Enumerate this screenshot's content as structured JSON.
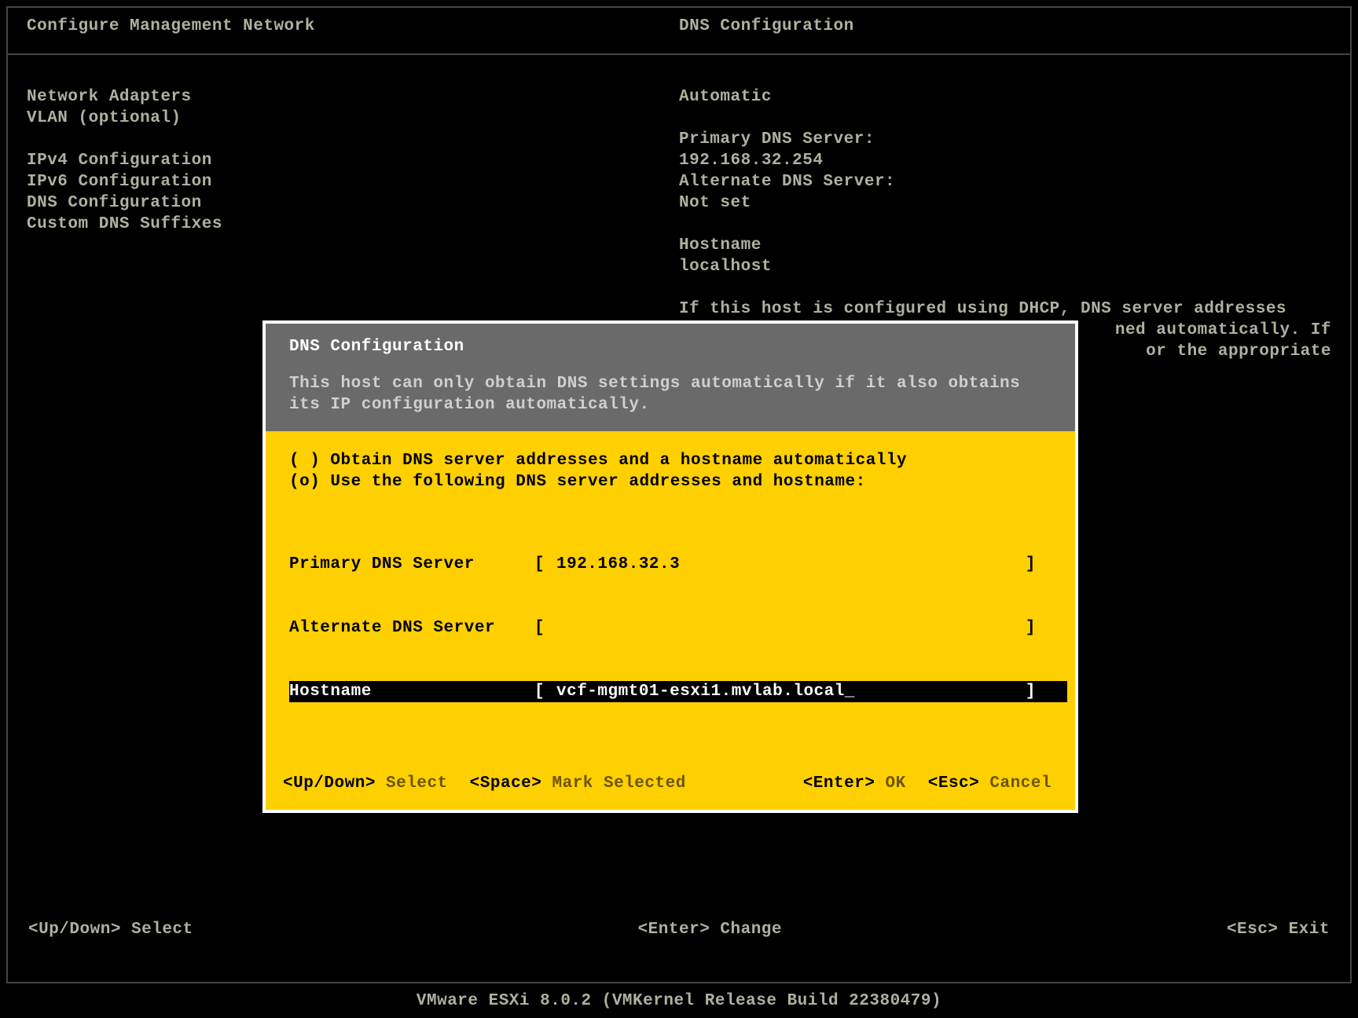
{
  "header": {
    "left": "Configure Management Network",
    "right": "DNS Configuration"
  },
  "menu": {
    "g1": [
      "Network Adapters",
      "VLAN (optional)"
    ],
    "g2": [
      "IPv4 Configuration",
      "IPv6 Configuration",
      "DNS Configuration",
      "Custom DNS Suffixes"
    ]
  },
  "info": {
    "mode": "Automatic",
    "primary_label": "Primary DNS Server:",
    "primary_value": "192.168.32.254",
    "alt_label": "Alternate DNS Server:",
    "alt_value": "Not set",
    "host_label": "Hostname",
    "host_value": "localhost",
    "note_l1": "If this host is configured using DHCP, DNS server addresses",
    "note_l2_a": "",
    "note_l2_b": "ned automatically. If",
    "note_l3_b": "or the appropriate"
  },
  "dialog": {
    "title": "DNS Configuration",
    "sub_l1": "This host can only obtain DNS settings automatically if it also obtains",
    "sub_l2": "its IP configuration automatically.",
    "opt_auto": "( ) Obtain DNS server addresses and a hostname automatically",
    "opt_manual": "(o) Use the following DNS server addresses and hostname:",
    "fields": {
      "primary_label": "Primary DNS Server",
      "primary_value": "192.168.32.3",
      "alt_label": "Alternate DNS Server",
      "alt_value": "",
      "host_label": "Hostname",
      "host_value": "vcf-mgmt01-esxi1.mvlab.local"
    },
    "hints": {
      "updown_k": "<Up/Down>",
      "updown_a": "Select",
      "space_k": "<Space>",
      "space_a": "Mark Selected",
      "enter_k": "<Enter>",
      "enter_a": "OK",
      "esc_k": "<Esc>",
      "esc_a": "Cancel"
    }
  },
  "footer": {
    "left": "<Up/Down> Select",
    "center": "<Enter> Change",
    "right": "<Esc> Exit"
  },
  "version": "VMware ESXi 8.0.2 (VMKernel Release Build 22380479)"
}
